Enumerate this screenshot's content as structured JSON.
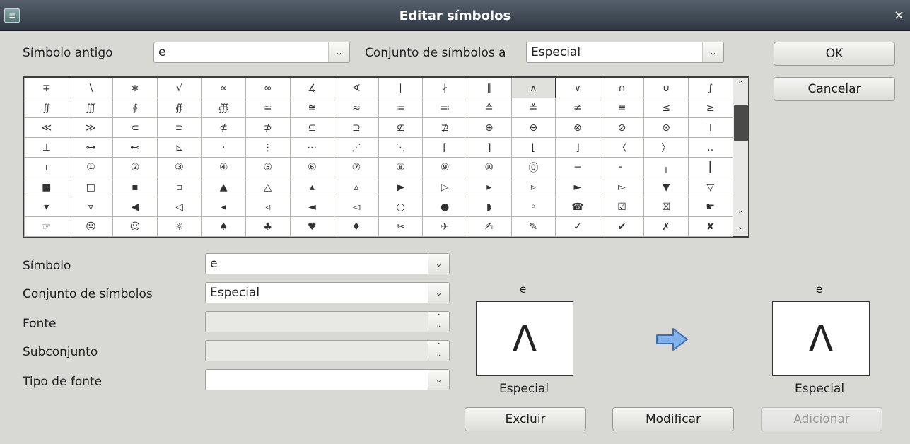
{
  "window": {
    "title": "Editar símbolos",
    "close_glyph": "×"
  },
  "top": {
    "old_symbol_label": "Símbolo antigo",
    "old_symbol_value": "e",
    "old_set_label": "Conjunto de símbolos a",
    "old_set_value": "Especial"
  },
  "buttons": {
    "ok": "OK",
    "cancel": "Cancelar",
    "delete": "Excluir",
    "modify": "Modificar",
    "add": "Adicionar"
  },
  "grid": {
    "rows": [
      [
        "∓",
        "∖",
        "∗",
        "√",
        "∝",
        "∞",
        "∡",
        "∢",
        "∣",
        "∤",
        "∥",
        "∧",
        "∨",
        "∩",
        "∪",
        "∫"
      ],
      [
        "∬",
        "∭",
        "∮",
        "∯",
        "∰",
        "≃",
        "≅",
        "≈",
        "≔",
        "≕",
        "≙",
        "≚",
        "≠",
        "≡",
        "≤",
        "≥"
      ],
      [
        "≪",
        "≫",
        "⊂",
        "⊃",
        "⊄",
        "⊅",
        "⊆",
        "⊇",
        "⊈",
        "⊉",
        "⊕",
        "⊖",
        "⊗",
        "⊘",
        "⊙",
        "⊤"
      ],
      [
        "⊥",
        "⊶",
        "⊷",
        "⊾",
        "⋅",
        "⋮",
        "⋯",
        "⋰",
        "⋱",
        "⌈",
        "⌉",
        "⌊",
        "⌋",
        "〈",
        "〉",
        "‥"
      ],
      [
        "ı",
        "①",
        "②",
        "③",
        "④",
        "⑤",
        "⑥",
        "⑦",
        "⑧",
        "⑨",
        "⑩",
        "⓪",
        "─",
        "╴",
        "╷",
        "┃"
      ],
      [
        "■",
        "□",
        "▪",
        "▫",
        "▲",
        "△",
        "▴",
        "▵",
        "▶",
        "▷",
        "▸",
        "▹",
        "►",
        "▻",
        "▼",
        "▽"
      ],
      [
        "▾",
        "▿",
        "◀",
        "◁",
        "◂",
        "◃",
        "◄",
        "◅",
        "○",
        "●",
        "◗",
        "◦",
        "☎",
        "☑",
        "☒",
        "☛"
      ],
      [
        "☞",
        "☹",
        "☺",
        "☼",
        "♠",
        "♣",
        "♥",
        "♦",
        "✂",
        "✈",
        "✍",
        "✎",
        "✓",
        "✔",
        "✗",
        "✘"
      ]
    ],
    "selected_row": 0,
    "selected_col": 11
  },
  "form": {
    "symbol_label": "Símbolo",
    "symbol_value": "e",
    "set_label": "Conjunto de símbolos",
    "set_value": "Especial",
    "font_label": "Fonte",
    "font_value": "",
    "subset_label": "Subconjunto",
    "subset_value": "",
    "font_type_label": "Tipo de fonte",
    "font_type_value": ""
  },
  "preview_left": {
    "name": "e",
    "glyph": "Λ",
    "set": "Especial"
  },
  "preview_right": {
    "name": "e",
    "glyph": "Λ",
    "set": "Especial"
  },
  "colors": {
    "arrow": "#5b8fd6",
    "titlebar": "#3b444e"
  },
  "icons": {
    "arrow": "arrow-right-icon",
    "dropdown": "chevron-down-icon",
    "spinner": "spin-updown-icon"
  }
}
